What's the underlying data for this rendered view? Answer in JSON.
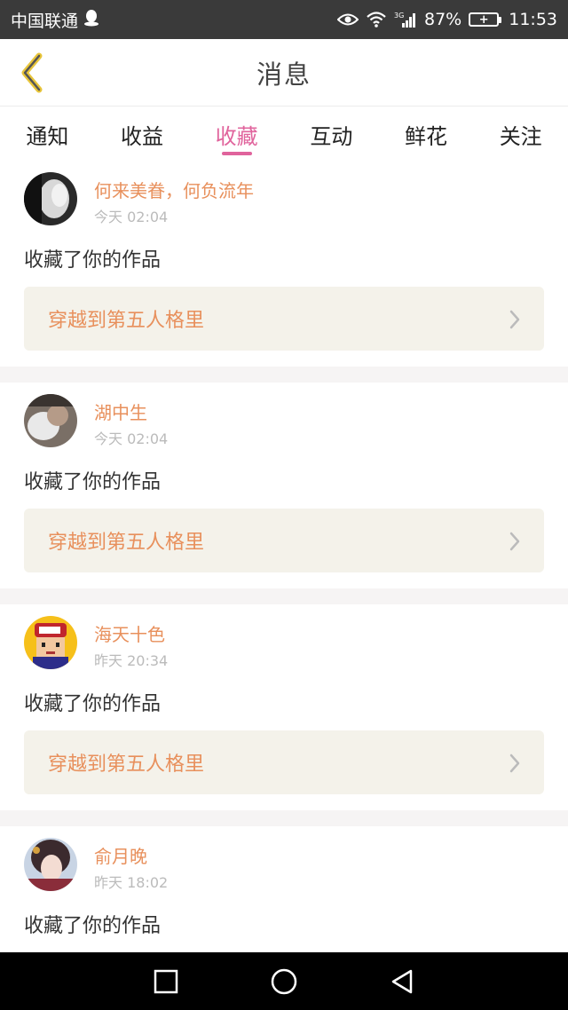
{
  "status": {
    "carrier": "中国联通",
    "network": "3G",
    "battery": "87%",
    "time": "11:53"
  },
  "header": {
    "title": "消息",
    "back_icon": "chevron-left-icon"
  },
  "tabs": [
    {
      "label": "通知"
    },
    {
      "label": "收益"
    },
    {
      "label": "收藏"
    },
    {
      "label": "互动"
    },
    {
      "label": "鲜花"
    },
    {
      "label": "关注"
    }
  ],
  "active_tab": "收藏",
  "messages": [
    {
      "user": "何来美眷，何负流年",
      "time": "今天 02:04",
      "action": "收藏了你的作品",
      "work": "穿越到第五人格里"
    },
    {
      "user": "湖中生",
      "time": "今天 02:04",
      "action": "收藏了你的作品",
      "work": "穿越到第五人格里"
    },
    {
      "user": "海天十色",
      "time": "昨天 20:34",
      "action": "收藏了你的作品",
      "work": "穿越到第五人格里"
    },
    {
      "user": "俞月晚",
      "time": "昨天 18:02",
      "action": "收藏了你的作品",
      "work": ""
    }
  ],
  "colors": {
    "accent": "#e0639c",
    "username": "#e8905c",
    "status_bar": "#3a3a3a",
    "work_bg": "#f4f2ea"
  }
}
